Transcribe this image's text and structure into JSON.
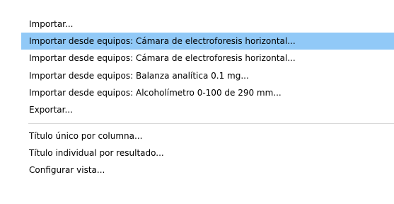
{
  "menu": {
    "items": [
      {
        "label": "Importar..."
      },
      {
        "label": "Importar desde equipos: Cámara de electroforesis horizontal...",
        "highlighted": true
      },
      {
        "label": "Importar desde equipos: Cámara de electroforesis horizontal..."
      },
      {
        "label": "Importar desde equipos: Balanza analítica 0.1 mg..."
      },
      {
        "label": "Importar desde equipos: Alcoholímetro 0-100 de 290 mm..."
      },
      {
        "label": "Exportar..."
      },
      {
        "label": "Título único por columna..."
      },
      {
        "label": "Título individual por resultado..."
      },
      {
        "label": "Configurar vista..."
      }
    ],
    "highlight_color": "#91c9f7"
  }
}
